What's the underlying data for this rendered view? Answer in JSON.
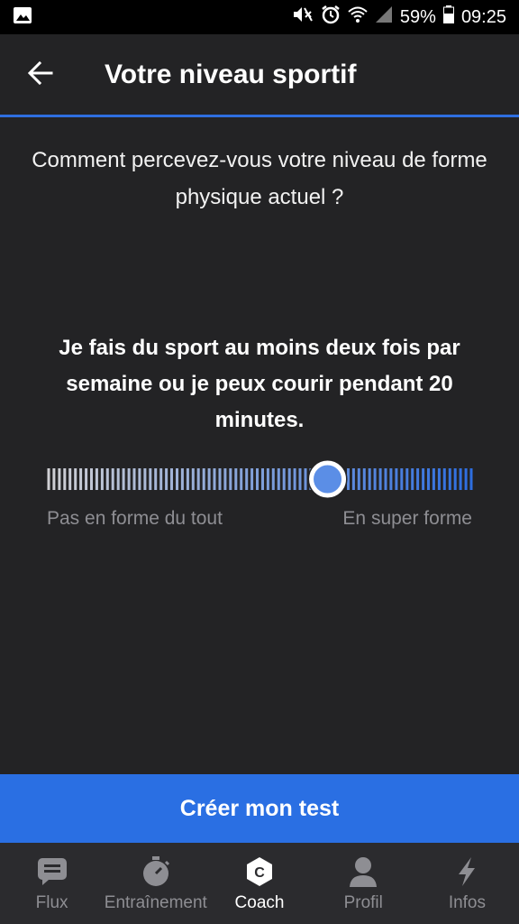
{
  "status_bar": {
    "battery": "59%",
    "time": "09:25",
    "icons": [
      "image-icon",
      "mute-icon",
      "alarm-icon",
      "wifi-icon",
      "signal-icon",
      "battery-icon"
    ]
  },
  "app_bar": {
    "title": "Votre niveau sportif",
    "back_icon": "arrow-left-icon"
  },
  "question": {
    "text": "Comment percevez-vous votre niveau de forme physique actuel ?"
  },
  "level": {
    "description": "Je fais du sport au moins deux fois par semaine ou je peux courir pendant 20 minutes.",
    "value_fraction": 0.66,
    "min_label": "Pas en forme du tout",
    "max_label": "En super forme"
  },
  "cta": {
    "label": "Créer mon test"
  },
  "bottom_nav": {
    "items": [
      {
        "label": "Flux",
        "icon": "chat-bubble-icon",
        "active": false
      },
      {
        "label": "Entraînement",
        "icon": "stopwatch-icon",
        "active": false
      },
      {
        "label": "Coach",
        "icon": "coach-badge-icon",
        "active": true
      },
      {
        "label": "Profil",
        "icon": "person-icon",
        "active": false
      },
      {
        "label": "Infos",
        "icon": "lightning-icon",
        "active": false
      }
    ]
  },
  "colors": {
    "background": "#232325",
    "accent": "#2a6fe3",
    "thumb": "#5b8ee6",
    "inactive_text": "#8e8e93"
  }
}
